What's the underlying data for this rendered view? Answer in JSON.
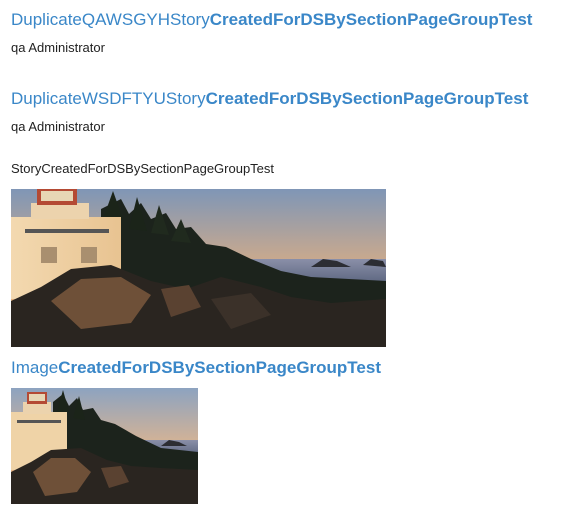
{
  "stories": [
    {
      "title_plain": "DuplicateQAWSGYHStory",
      "title_bold": "CreatedForDSBySectionPageGroupTest",
      "author": "qa Administrator"
    },
    {
      "title_plain": "DuplicateWSDFTYUStory",
      "title_bold": "CreatedForDSBySectionPageGroupTest",
      "author": "qa Administrator"
    }
  ],
  "story_text_item": {
    "title": "StoryCreatedForDSBySectionPageGroupTest"
  },
  "image_item": {
    "title_plain": "Image",
    "title_bold": "CreatedForDSBySectionPageGroupTest"
  },
  "theme": {
    "link_color": "#3a87c8",
    "text_color": "#222222"
  }
}
